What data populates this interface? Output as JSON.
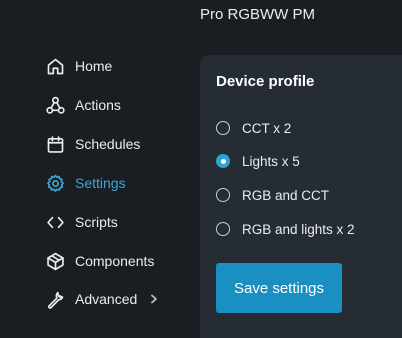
{
  "header": {
    "device_title": "Pro RGBWW PM"
  },
  "sidebar": {
    "items": [
      {
        "label": "Home",
        "icon": "home-icon"
      },
      {
        "label": "Actions",
        "icon": "actions-icon"
      },
      {
        "label": "Schedules",
        "icon": "calendar-icon"
      },
      {
        "label": "Settings",
        "icon": "gear-icon",
        "active": true
      },
      {
        "label": "Scripts",
        "icon": "code-icon"
      },
      {
        "label": "Components",
        "icon": "components-icon"
      },
      {
        "label": "Advanced",
        "icon": "wrench-icon",
        "has_chevron": true
      }
    ]
  },
  "device_profile": {
    "title": "Device profile",
    "selected": "Lights x 5",
    "options": [
      {
        "label": "CCT x 2",
        "checked": false
      },
      {
        "label": "Lights x 5",
        "checked": true
      },
      {
        "label": "RGB and CCT",
        "checked": false
      },
      {
        "label": "RGB and lights x 2",
        "checked": false
      }
    ],
    "save_label": "Save settings"
  },
  "colors": {
    "background": "#191e23",
    "card": "#262c33",
    "accent": "#2ea3d4",
    "button": "#1a8fc1",
    "active_nav": "#3aa5d6"
  }
}
